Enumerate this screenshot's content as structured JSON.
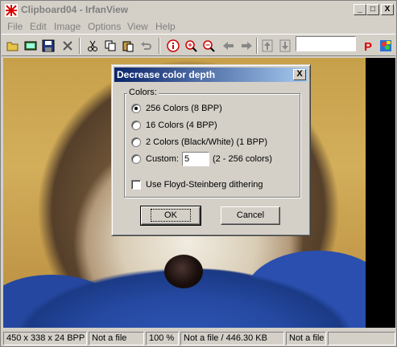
{
  "window": {
    "title": "Clipboard04 - IrfanView"
  },
  "caption_buttons": {
    "minimize": "_",
    "maximize": "□",
    "close": "X"
  },
  "menu": [
    "File",
    "Edit",
    "Image",
    "Options",
    "View",
    "Help"
  ],
  "toolbar": {
    "icons": [
      "open-folder-icon",
      "slideshow-icon",
      "save-icon",
      "delete-icon",
      "cut-icon",
      "copy-icon",
      "paste-icon",
      "undo-icon",
      "info-icon",
      "zoom-in-icon",
      "zoom-out-icon",
      "previous-icon",
      "next-icon",
      "first-icon",
      "last-icon",
      "print-icon",
      "paint-icon"
    ],
    "search_value": ""
  },
  "dialog": {
    "title": "Decrease color depth",
    "close": "X",
    "group_label": "Colors:",
    "options": [
      {
        "label": "256 Colors (8 BPP)",
        "checked": true
      },
      {
        "label": "16 Colors (4 BPP)",
        "checked": false
      },
      {
        "label": "2 Colors (Black/White) (1 BPP)",
        "checked": false
      },
      {
        "label": "Custom:",
        "checked": false
      }
    ],
    "custom_value": "5",
    "custom_hint": "(2 - 256 colors)",
    "dithering_label": "Use Floyd-Steinberg dithering",
    "ok_label": "OK",
    "cancel_label": "Cancel"
  },
  "status": {
    "dimensions": "450 x 338 x 24 BPP",
    "file1": "Not a file",
    "zoom": "100 %",
    "file_size": "Not a file / 446.30 KB",
    "file2": "Not a file"
  }
}
